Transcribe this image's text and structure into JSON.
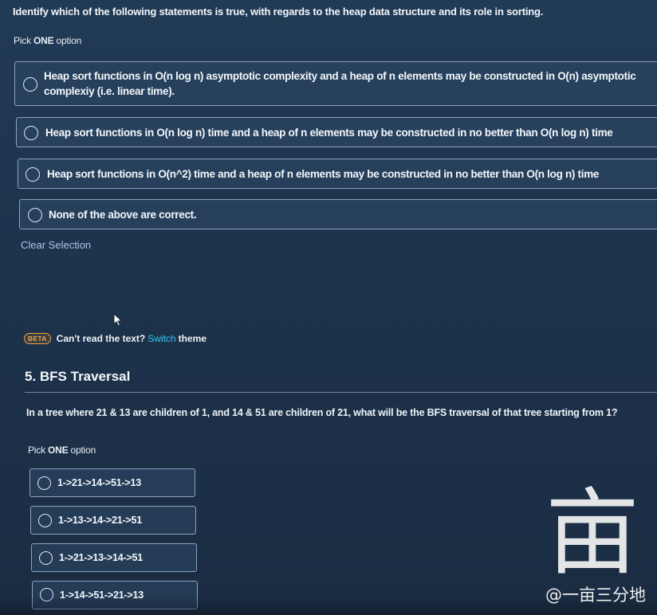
{
  "question1": {
    "text": "Identify which of the following statements is true, with regards to the heap data structure and its role in sorting.",
    "pick_prefix": "Pick ",
    "pick_bold": "ONE",
    "pick_suffix": " option",
    "options": [
      {
        "label": "Heap sort functions in O(n log n) asymptotic complexity and a heap of n elements may be constructed in O(n) asymptotic complexiy (i.e. linear time)."
      },
      {
        "label": "Heap sort functions in O(n log n) time and a heap of n elements may be constructed in no better than O(n log n) time"
      },
      {
        "label": "Heap sort functions in O(n^2) time and a heap of n elements may be constructed in no better than O(n log n) time"
      },
      {
        "label": "None of the above are correct."
      }
    ],
    "clear_label": "Clear Selection"
  },
  "theme_notice": {
    "badge": "BETA",
    "text_before": "Can't read the text?",
    "link": "Switch",
    "text_after": "theme"
  },
  "question2": {
    "title": "5. BFS Traversal",
    "text": "In a tree where 21 & 13 are children of 1, and 14 & 51 are children of 21, what will be the BFS traversal of that tree starting from 1?",
    "pick_prefix": "Pick ",
    "pick_bold": "ONE",
    "pick_suffix": " option",
    "options": [
      {
        "label": "1->21->14->51->13"
      },
      {
        "label": "1->13->14->21->51"
      },
      {
        "label": "1->21->13->14->51"
      },
      {
        "label": "1->14->51->21->13"
      }
    ]
  },
  "watermark": {
    "glyph": "亩",
    "text": "@一亩三分地"
  },
  "colors": {
    "background": "#1d334c",
    "option_border": "#8ba3bd",
    "link": "#37c4f0",
    "beta": "#f3a43c"
  }
}
